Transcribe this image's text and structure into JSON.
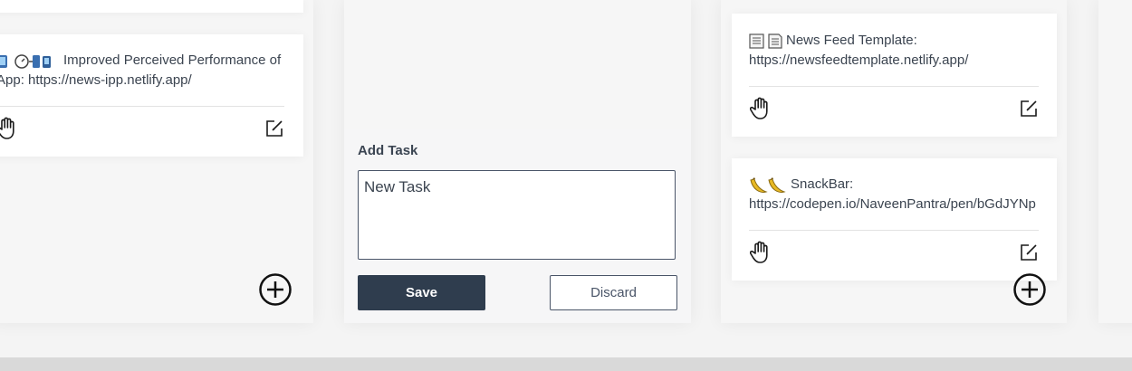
{
  "columns": {
    "left": {
      "card": {
        "text_line1": "Improved Perceived Performance of",
        "text_line2": "App: https://news-ipp.netlify.app/",
        "emoji_icons": [
          "tablet-icon",
          "gauge-icon",
          "phones-icon"
        ]
      }
    },
    "middle": {
      "add_task": {
        "label": "Add Task",
        "input_value": "New Task",
        "save_label": "Save",
        "discard_label": "Discard"
      }
    },
    "right": {
      "cards": [
        {
          "text_line1": "News Feed Template:",
          "text_line2": "https://newsfeedtemplate.netlify.app/",
          "emoji_icons": [
            "page-icon",
            "document-icon"
          ]
        },
        {
          "text_line1": "SnackBar:",
          "text_line2": "https://codepen.io/NaveenPantra/pen/bGdJYNp",
          "emoji_icons": [
            "banana-icon",
            "banana-icon"
          ]
        }
      ]
    }
  },
  "colors": {
    "save_button": "#2f3d4e",
    "text": "#3b4450",
    "banana": "#e8b923"
  }
}
